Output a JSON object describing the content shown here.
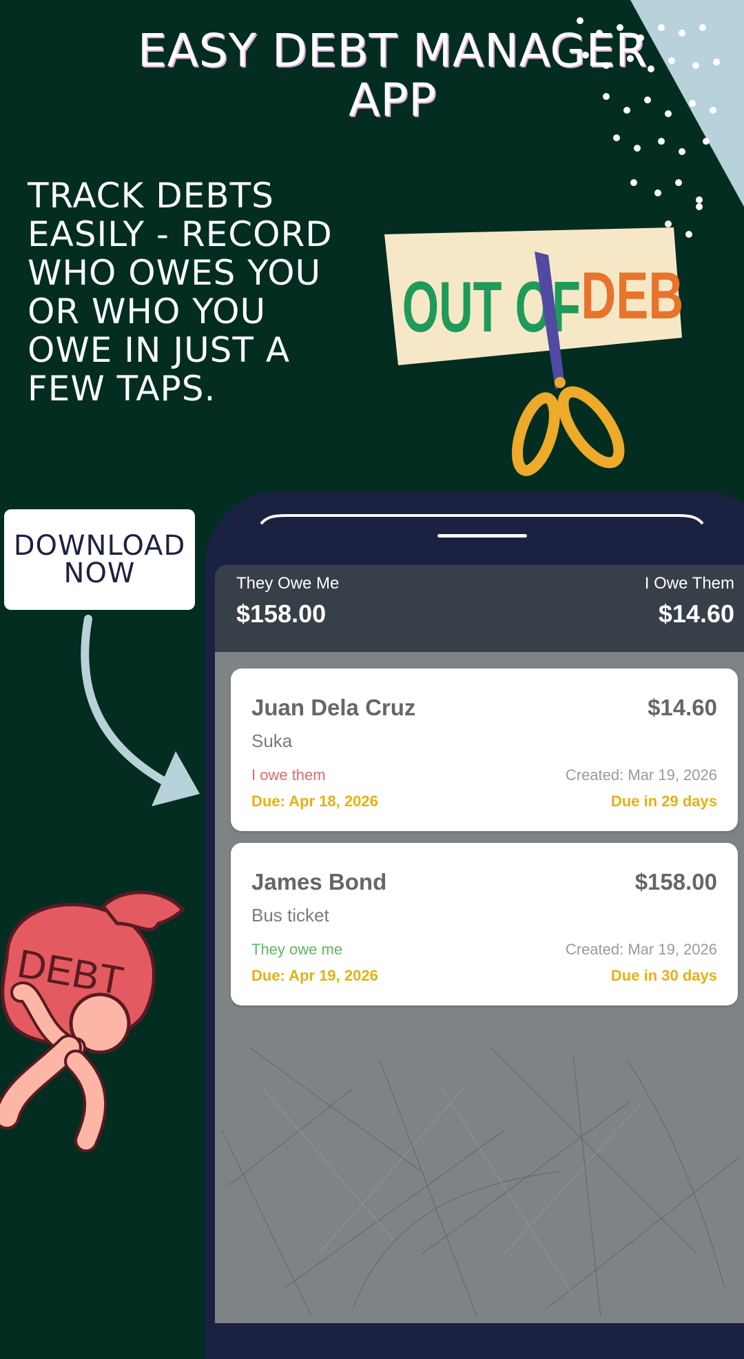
{
  "title_line1": "EASY DEBT MANAGER",
  "title_line2": "APP",
  "tagline_lines": [
    "TRACK DEBTS",
    "EASILY - RECORD",
    "WHO OWES YOU",
    "OR WHO YOU",
    "OWE IN JUST A",
    "FEW TAPS."
  ],
  "note": {
    "left": "OUT OF",
    "right": "DEBT"
  },
  "download": {
    "line1": "DOWNLOAD",
    "line2": "NOW"
  },
  "bag_label": "DEBT",
  "summary": {
    "they_owe_label": "They Owe Me",
    "they_owe_value": "$158.00",
    "i_owe_label": "I Owe Them",
    "i_owe_value": "$14.60"
  },
  "debts": [
    {
      "name": "Juan Dela Cruz",
      "amount": "$14.60",
      "note": "Suka",
      "direction": "I owe them",
      "direction_color": "#e06a6a",
      "created": "Created: Mar 19, 2026",
      "due": "Due: Apr 18, 2026",
      "due_in": "Due in 29 days"
    },
    {
      "name": "James Bond",
      "amount": "$158.00",
      "note": "Bus ticket",
      "direction": "They owe me",
      "direction_color": "#5cb85c",
      "created": "Created: Mar 19, 2026",
      "due": "Due: Apr 19, 2026",
      "due_in": "Due in 30 days"
    }
  ],
  "colors": {
    "background": "#032d20",
    "phone": "#1b2141",
    "summary_bar": "#373f49",
    "due_accent": "#e8b010"
  }
}
